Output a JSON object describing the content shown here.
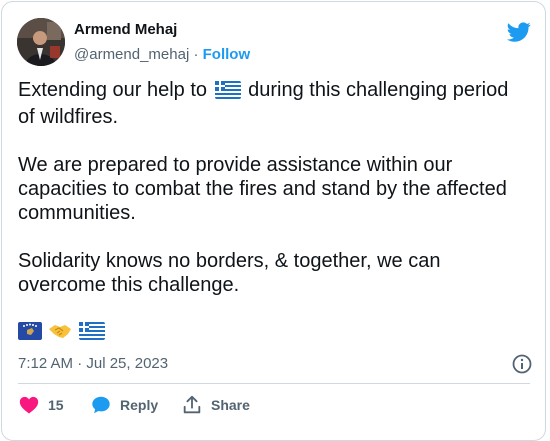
{
  "author": {
    "name": "Armend Mehaj",
    "handle": "@armend_mehaj",
    "separator": " · ",
    "follow_label": "Follow"
  },
  "tweet": {
    "line1_before_flag": "Extending our help to ",
    "line1_after_flag": " during this challenging period of wildfires.",
    "paragraph2": "We are prepared to provide assistance within our capacities to combat the fires and stand by the affected communities.",
    "paragraph3": "Solidarity knows no borders, & together, we can overcome this challenge.",
    "emojis": [
      "kosovo-flag",
      "handshake",
      "greece-flag"
    ],
    "timestamp": "7:12 AM · Jul 25, 2023"
  },
  "actions": {
    "likes_count": "15",
    "reply_label": "Reply",
    "share_label": "Share"
  },
  "colors": {
    "accent": "#1d9bf0",
    "text": "#0f1419",
    "muted": "#536471",
    "like": "#f91880",
    "border": "#cfd9de"
  }
}
